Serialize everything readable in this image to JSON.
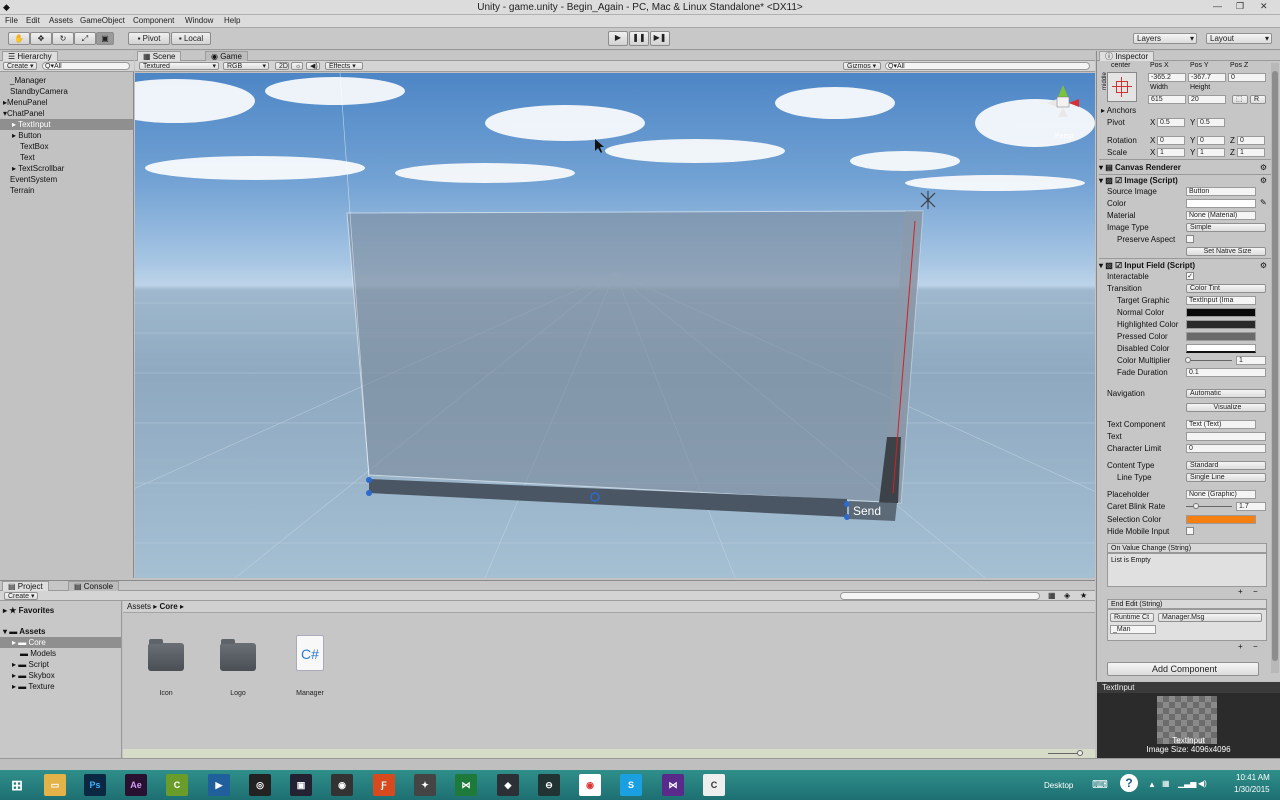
{
  "window": {
    "title": "Unity - game.unity - Begin_Again - PC, Mac & Linux Standalone* <DX11>"
  },
  "menu": [
    "File",
    "Edit",
    "Assets",
    "GameObject",
    "Component",
    "Window",
    "Help"
  ],
  "toolbar": {
    "pivot_label": "Pivot",
    "local_label": "Local",
    "layers_label": "Layers",
    "layout_label": "Layout"
  },
  "hierarchy": {
    "tab": "Hierarchy",
    "create_label": "Create",
    "search_placeholder": "Q▾All",
    "items": [
      {
        "label": "_Manager"
      },
      {
        "label": "StandbyCamera"
      },
      {
        "label": "MenuPanel"
      },
      {
        "label": "ChatPanel"
      },
      {
        "label": "TextInput"
      },
      {
        "label": "Button"
      },
      {
        "label": "TextBox"
      },
      {
        "label": "Text"
      },
      {
        "label": "TextScrollbar"
      },
      {
        "label": "EventSystem"
      },
      {
        "label": "Terrain"
      }
    ]
  },
  "scene": {
    "tab_scene": "Scene",
    "tab_game": "Game",
    "shading_mode": "Textured",
    "render_mode": "RGB",
    "mode_2d": "2D",
    "effects_label": "Effects",
    "gizmos_label": "Gizmos",
    "search_placeholder": "Q▾All",
    "persp_label": "Persp",
    "send_label": "Send"
  },
  "inspector": {
    "tab": "Inspector",
    "anchor_h": "center",
    "anchor_v": "middle",
    "pos_x_label": "Pos X",
    "pos_x": "-365.2",
    "pos_y_label": "Pos Y",
    "pos_y": "-367.7",
    "pos_z_label": "Pos Z",
    "pos_z": "0",
    "width_label": "Width",
    "width": "615",
    "height_label": "Height",
    "height": "20",
    "anchors_label": "Anchors",
    "pivot_label": "Pivot",
    "pivot_x": "0.5",
    "pivot_y": "0.5",
    "rotation_label": "Rotation",
    "rot_x": "0",
    "rot_y": "0",
    "rot_z": "0",
    "scale_label": "Scale",
    "scale_x": "1",
    "scale_y": "1",
    "scale_z": "1",
    "canvas_renderer": "Canvas Renderer",
    "image_script": "Image (Script)",
    "source_image_label": "Source Image",
    "source_image": "Button",
    "color_label": "Color",
    "material_label": "Material",
    "material": "None (Material)",
    "image_type_label": "Image Type",
    "image_type": "Simple",
    "preserve_aspect_label": "Preserve Aspect",
    "set_native_size": "Set Native Size",
    "input_field": "Input Field (Script)",
    "interactable_label": "Interactable",
    "transition_label": "Transition",
    "transition": "Color Tint",
    "target_graphic_label": "Target Graphic",
    "target_graphic": "TextInput (Ima",
    "normal_color_label": "Normal Color",
    "highlighted_color_label": "Highlighted Color",
    "pressed_color_label": "Pressed Color",
    "disabled_color_label": "Disabled Color",
    "color_multiplier_label": "Color Multiplier",
    "color_multiplier": "1",
    "fade_duration_label": "Fade Duration",
    "fade_duration": "0.1",
    "navigation_label": "Navigation",
    "navigation": "Automatic",
    "visualize_label": "Visualize",
    "text_component_label": "Text Component",
    "text_component": "Text (Text)",
    "text_label": "Text",
    "char_limit_label": "Character Limit",
    "char_limit": "0",
    "content_type_label": "Content Type",
    "content_type": "Standard",
    "line_type_label": "Line Type",
    "line_type": "Single Line",
    "placeholder_label": "Placeholder",
    "placeholder": "None (Graphic)",
    "caret_blink_label": "Caret Blink Rate",
    "caret_blink": "1.7",
    "selection_color_label": "Selection Color",
    "hide_mobile_label": "Hide Mobile Input",
    "on_value_change": "On Value Change (String)",
    "list_empty": "List is Empty",
    "end_edit": "End Edit (String)",
    "runtime_label": "Runtime Ct",
    "method_label": "Manager.Msg",
    "object_label": "_Man",
    "add_component": "Add Component",
    "preview_title": "TextInput",
    "preview_name": "TextInput",
    "preview_size": "Image Size: 4096x4096"
  },
  "project": {
    "tab_project": "Project",
    "tab_console": "Console",
    "create_label": "Create",
    "favorites_label": "Favorites",
    "assets_label": "Assets",
    "tree": [
      "Core",
      "Models",
      "Script",
      "Skybox",
      "Texture"
    ],
    "breadcrumb_root": "Assets",
    "breadcrumb_leaf": "Core",
    "assets": [
      {
        "label": "Icon",
        "kind": "folder-icon"
      },
      {
        "label": "Logo",
        "kind": "folder-icon"
      },
      {
        "label": "Manager",
        "kind": "csharp-file-icon"
      }
    ]
  },
  "taskbar": {
    "desktop_label": "Desktop",
    "time": "10:41 AM",
    "date": "1/30/2015"
  },
  "colors": {
    "selection_orange": "#f57f10",
    "taskbar_teal": "#2f8f8a",
    "sky_blue": "#5f92c8"
  }
}
